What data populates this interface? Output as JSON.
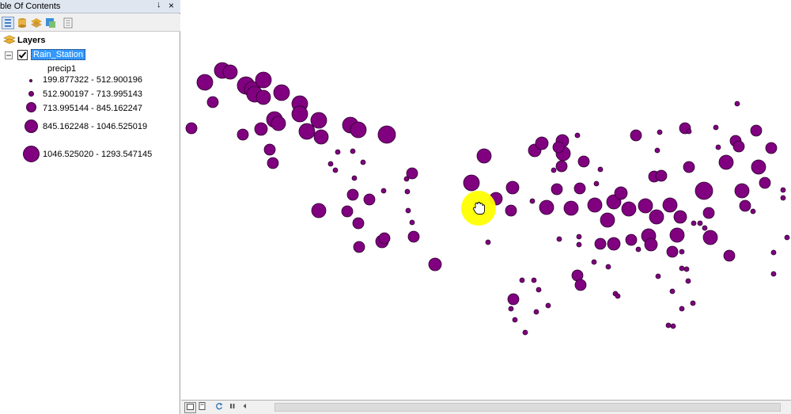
{
  "toc": {
    "title": "ble Of Contents",
    "pin_glyph": "↓",
    "close_glyph": "×",
    "toolbar": [
      {
        "name": "list-by-drawing-order-icon",
        "color": "#4a7fc0"
      },
      {
        "name": "list-by-source-icon",
        "color": "#d19a2a"
      },
      {
        "name": "list-by-visibility-icon",
        "color": "#e0a830"
      },
      {
        "name": "list-by-selection-icon",
        "color": "#3b8fd9"
      },
      {
        "name": "options-icon",
        "color": "#888888"
      }
    ],
    "layers_label": "Layers",
    "layer": {
      "name": "Rain_Station",
      "checked": true,
      "field": "precip1"
    },
    "legend": [
      {
        "label": "199.877322 - 512.900196"
      },
      {
        "label": "512.900197 - 713.995143"
      },
      {
        "label": "713.995144 - 845.162247"
      },
      {
        "label": "845.162248 - 1046.525019"
      },
      {
        "label": "1046.525020 - 1293.547145"
      }
    ]
  },
  "map": {
    "symbol_fill": "#800080",
    "symbol_stroke": "#2b002b",
    "cursor_highlight": "#ffff00",
    "cursor_icon": "pan-hand-icon"
  },
  "status_bar": {
    "buttons": [
      "data-view-icon",
      "layout-view-icon",
      "refresh-icon",
      "pause-icon",
      "scroll-left-icon"
    ]
  }
}
